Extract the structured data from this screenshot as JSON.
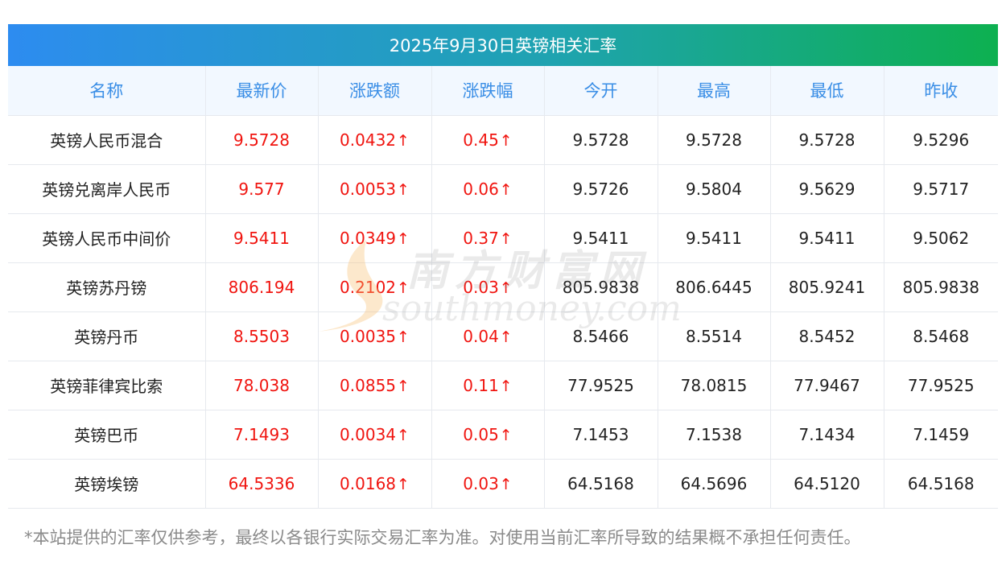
{
  "title": "2025年9月30日英镑相关汇率",
  "headers": [
    "名称",
    "最新价",
    "涨跌额",
    "涨跌幅",
    "今开",
    "最高",
    "最低",
    "昨收"
  ],
  "rows": [
    {
      "name": "英镑人民币混合",
      "latest": "9.5728",
      "change": "0.0432",
      "change_pct": "0.45",
      "open": "9.5728",
      "high": "9.5728",
      "low": "9.5728",
      "prev_close": "9.5296"
    },
    {
      "name": "英镑兑离岸人民币",
      "latest": "9.577",
      "change": "0.0053",
      "change_pct": "0.06",
      "open": "9.5726",
      "high": "9.5804",
      "low": "9.5629",
      "prev_close": "9.5717"
    },
    {
      "name": "英镑人民币中间价",
      "latest": "9.5411",
      "change": "0.0349",
      "change_pct": "0.37",
      "open": "9.5411",
      "high": "9.5411",
      "low": "9.5411",
      "prev_close": "9.5062"
    },
    {
      "name": "英镑苏丹镑",
      "latest": "806.194",
      "change": "0.2102",
      "change_pct": "0.03",
      "open": "805.9838",
      "high": "806.6445",
      "low": "805.9241",
      "prev_close": "805.9838"
    },
    {
      "name": "英镑丹币",
      "latest": "8.5503",
      "change": "0.0035",
      "change_pct": "0.04",
      "open": "8.5466",
      "high": "8.5514",
      "low": "8.5452",
      "prev_close": "8.5468"
    },
    {
      "name": "英镑菲律宾比索",
      "latest": "78.038",
      "change": "0.0855",
      "change_pct": "0.11",
      "open": "77.9525",
      "high": "78.0815",
      "low": "77.9467",
      "prev_close": "77.9525"
    },
    {
      "name": "英镑巴币",
      "latest": "7.1493",
      "change": "0.0034",
      "change_pct": "0.05",
      "open": "7.1453",
      "high": "7.1538",
      "low": "7.1434",
      "prev_close": "7.1459"
    },
    {
      "name": "英镑埃镑",
      "latest": "64.5336",
      "change": "0.0168",
      "change_pct": "0.03",
      "open": "64.5168",
      "high": "64.5696",
      "low": "64.5120",
      "prev_close": "64.5168"
    }
  ],
  "up_arrow": "↑",
  "watermark": {
    "cn": "南方财富网",
    "en": "southmoney.com"
  },
  "footnote": "*本站提供的汇率仅供参考，最终以各银行实际交易汇率为准。对使用当前汇率所导致的结果概不承担任何责任。",
  "colors": {
    "up": "#f0140f",
    "header_text": "#3a8ee6",
    "header_bg": "#f2f8ff",
    "title_gradient_start": "#2d8cf0",
    "title_gradient_end": "#0db050"
  }
}
